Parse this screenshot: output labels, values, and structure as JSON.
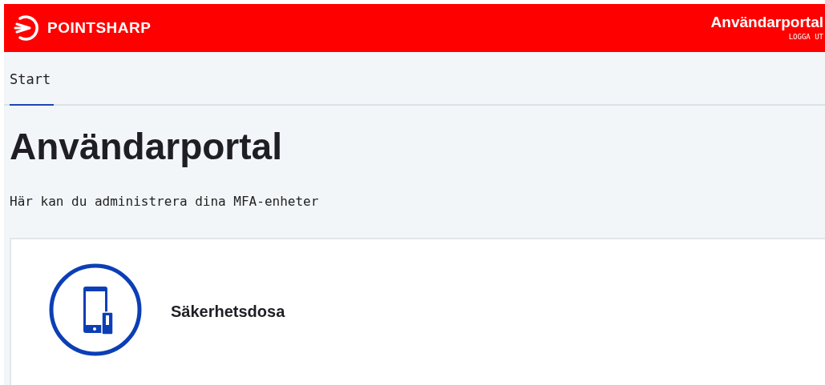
{
  "header": {
    "brand": "POINTSHARP",
    "title": "Användarportal",
    "logout": "LOGGA UT"
  },
  "tabs": [
    {
      "label": "Start",
      "selected": true
    }
  ],
  "heading": "Användarportal",
  "description": "Här kan du administrera dina MFA-enheter",
  "cards": [
    {
      "label": "Säkerhetsdosa"
    }
  ]
}
